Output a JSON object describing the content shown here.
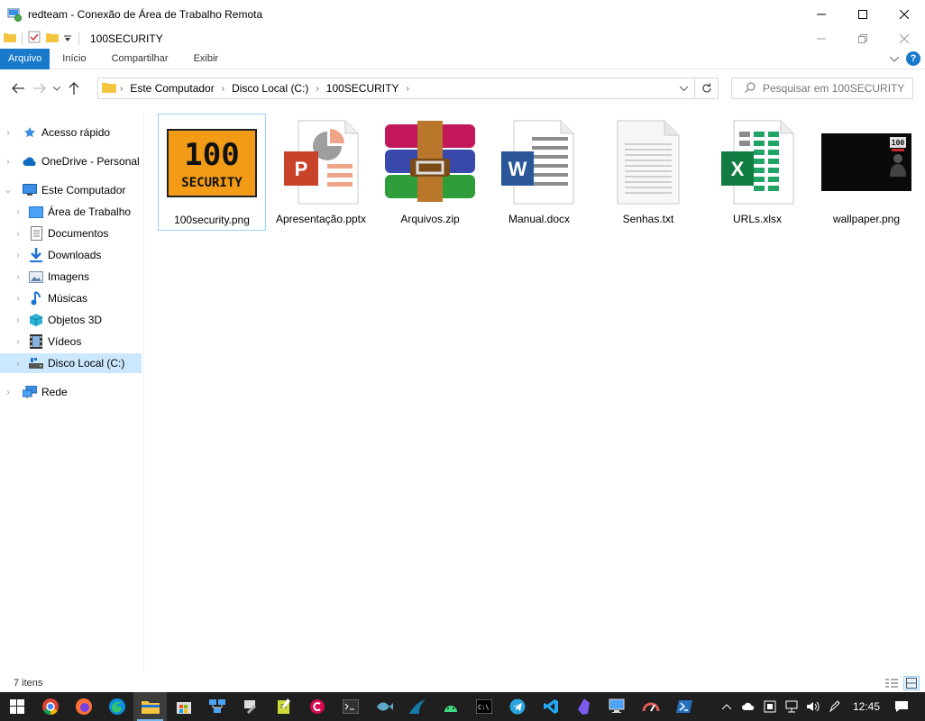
{
  "window": {
    "title": "redteam - Conexão de Área de Trabalho Remota",
    "inner_title": "100SECURITY"
  },
  "ribbon": {
    "tabs": [
      "Arquivo",
      "Início",
      "Compartilhar",
      "Exibir"
    ]
  },
  "address": {
    "crumbs": [
      "Este Computador",
      "Disco Local (C:)",
      "100SECURITY"
    ]
  },
  "search": {
    "placeholder": "Pesquisar em 100SECURITY"
  },
  "nav": {
    "items": [
      {
        "label": "Acesso rápido",
        "icon": "star-icon"
      },
      {
        "label": "OneDrive - Personal",
        "icon": "cloud-icon"
      },
      {
        "label": "Este Computador",
        "icon": "monitor-icon"
      },
      {
        "label": "Área de Trabalho",
        "icon": "desktop-icon"
      },
      {
        "label": "Documentos",
        "icon": "document-icon"
      },
      {
        "label": "Downloads",
        "icon": "download-icon"
      },
      {
        "label": "Imagens",
        "icon": "image-icon"
      },
      {
        "label": "Músicas",
        "icon": "music-icon"
      },
      {
        "label": "Objetos 3D",
        "icon": "cube-icon"
      },
      {
        "label": "Vídeos",
        "icon": "video-icon"
      },
      {
        "label": "Disco Local (C:)",
        "icon": "drive-icon"
      },
      {
        "label": "Rede",
        "icon": "network-icon"
      }
    ]
  },
  "files": [
    {
      "name": "100security.png",
      "type": "png-logo"
    },
    {
      "name": "Apresentação.pptx",
      "type": "pptx"
    },
    {
      "name": "Arquivos.zip",
      "type": "zip"
    },
    {
      "name": "Manual.docx",
      "type": "docx"
    },
    {
      "name": "Senhas.txt",
      "type": "txt"
    },
    {
      "name": "URLs.xlsx",
      "type": "xlsx"
    },
    {
      "name": "wallpaper.png",
      "type": "png-wallpaper"
    }
  ],
  "logo_text": {
    "top": "100",
    "bottom": "SECURITY"
  },
  "status": {
    "count": "7 itens"
  },
  "taskbar": {
    "clock": "12:45"
  },
  "colors": {
    "accent": "#1979ca",
    "selection": "#cce8ff",
    "taskbar": "#1f1f1f"
  }
}
